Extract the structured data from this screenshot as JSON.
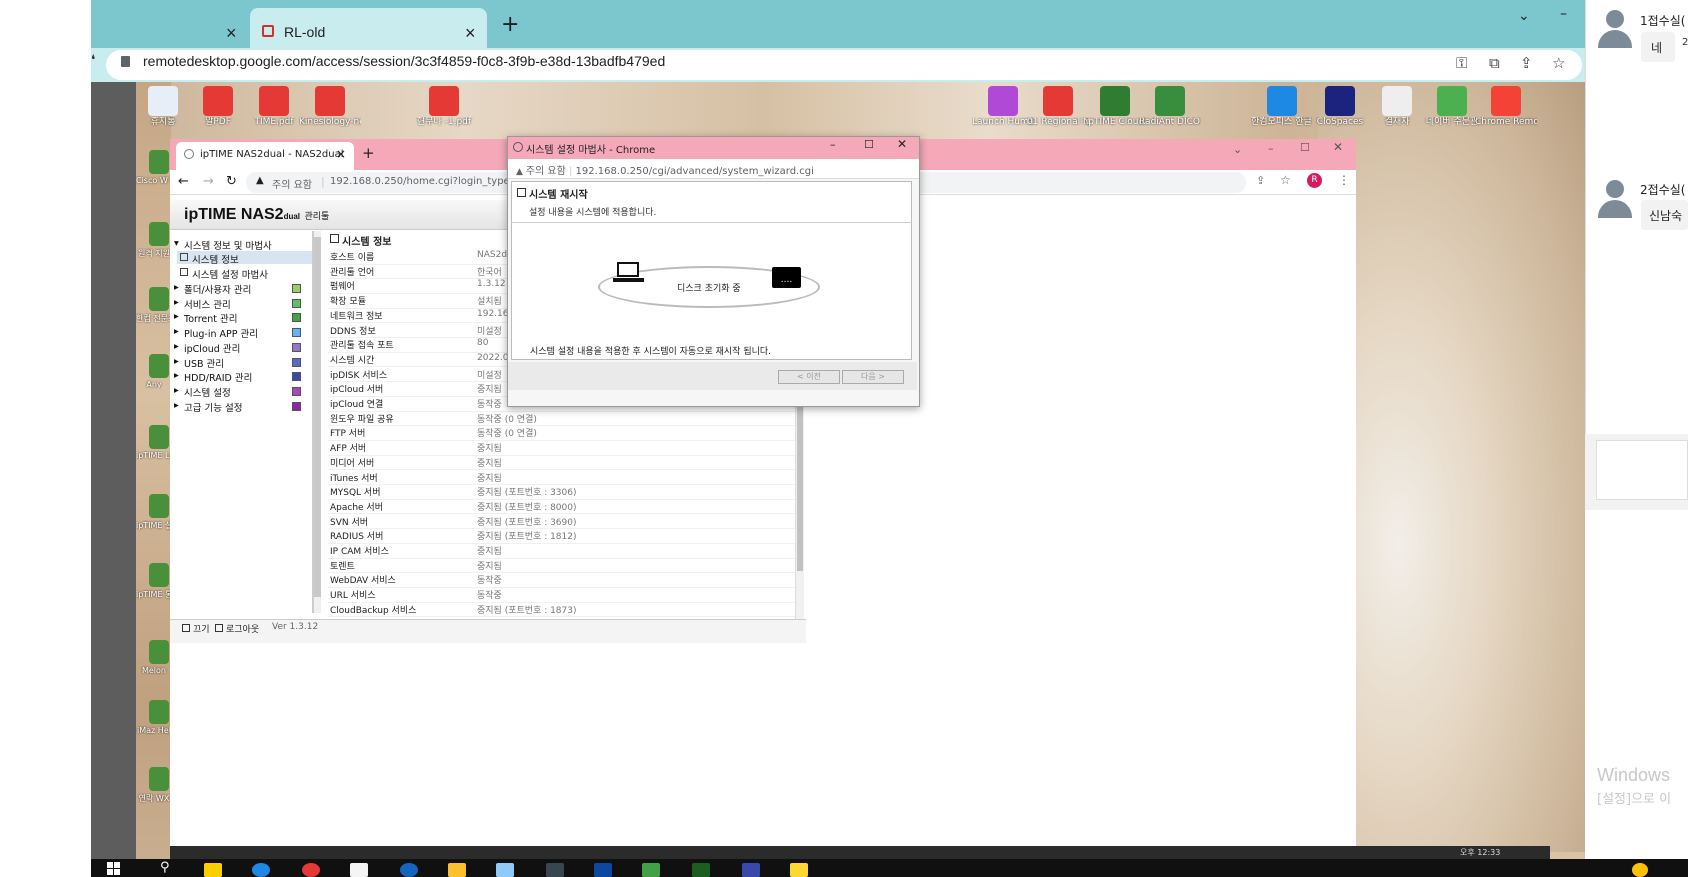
{
  "outer_browser": {
    "tab_active_title": "RL-old",
    "new_tab": "+",
    "url": "remotedesktop.google.com/access/session/3c3f4859-f0c8-3f9b-e38d-13badfb479ed"
  },
  "desktop_icons": [
    {
      "label": "휴지통",
      "color": "#e8eef7"
    },
    {
      "label": "알PDF",
      "color": "#e53935"
    },
    {
      "label": "TIME.pdf",
      "color": "#e53935"
    },
    {
      "label": "Kinesiology-neumann.pdf",
      "color": "#e53935"
    },
    {
      "label": "현무나 -1.pdf",
      "color": "#e53935"
    },
    {
      "label": "Launch Human",
      "color": "#b04ad6"
    },
    {
      "label": "01 Regional News Bio...",
      "color": "#e53935"
    },
    {
      "label": "ipTIME Cloud",
      "color": "#2e7d32"
    },
    {
      "label": "RadiAnt DICO...",
      "color": "#388e3c"
    },
    {
      "label": "한컴오피스 한글 2010",
      "color": "#1e88e5"
    },
    {
      "label": "CloSpaces",
      "color": "#1a237e"
    },
    {
      "label": "결재자",
      "color": "#eeeeee"
    },
    {
      "label": "네이버 주문관",
      "color": "#4caf50"
    },
    {
      "label": "Chrome Remot...",
      "color": "#f44336"
    }
  ],
  "left_desktop_icons": [
    "Cisco W Meet",
    "원격 지원",
    "한컴 전문조",
    "Any",
    "ipTIME Live",
    "ipTIME 설정",
    "ipTIME 통합",
    "Melon",
    "iMaz Hel",
    "연락 WX"
  ],
  "inner_browser": {
    "tab_title": "ipTIME NAS2dual - NAS2dual",
    "url_warning": "주의 요함",
    "url": "192.168.0.250/home.cgi?login_type="
  },
  "nas": {
    "logo": "ipTIME NAS2",
    "logo_sub": "dual",
    "logo_suffix": "관리툴",
    "nav_root": "시스템 정보 및 마법사",
    "nav_children": [
      "시스템 정보",
      "시스템 설정 마법사"
    ],
    "nav_items": [
      "폴더/사용자 관리",
      "서비스 관리",
      "Torrent 관리",
      "Plug-in APP 관리",
      "ipCloud 관리",
      "USB 관리",
      "HDD/RAID 관리",
      "시스템 설정",
      "고급 기능 설정"
    ],
    "panel_title": "시스템 정보",
    "rows": [
      {
        "k": "호스트 이름",
        "v": "NAS2d"
      },
      {
        "k": "관리툴 언어",
        "v": "한국어"
      },
      {
        "k": "펌웨어",
        "v": "1.3.12"
      },
      {
        "k": "확장 모듈",
        "v": "설치됨"
      },
      {
        "k": "네트워크 정보",
        "v": "192.16"
      },
      {
        "k": "DDNS 정보",
        "v": "미설정"
      },
      {
        "k": "관리툴 접속 포트",
        "v": "80"
      },
      {
        "k": "시스템 시간",
        "v": "2022.0"
      },
      {
        "k": "ipDISK 서비스",
        "v": "미설정"
      },
      {
        "k": "ipCloud 서버",
        "v": "중지됨"
      },
      {
        "k": "ipCloud 연결",
        "v": "동작중"
      },
      {
        "k": "윈도우 파일 공유",
        "v": "동작중 (0 연결)"
      },
      {
        "k": "FTP 서버",
        "v": "동작중 (0 연결)"
      },
      {
        "k": "AFP 서버",
        "v": "중지됨"
      },
      {
        "k": "미디어 서버",
        "v": "중지됨"
      },
      {
        "k": "iTunes 서버",
        "v": "중지됨"
      },
      {
        "k": "MYSQL 서버",
        "v": "중지됨 (포트번호 : 3306)"
      },
      {
        "k": "Apache 서버",
        "v": "중지됨 (포트번호 : 8000)"
      },
      {
        "k": "SVN 서버",
        "v": "중지됨 (포트번호 : 3690)"
      },
      {
        "k": "RADIUS 서버",
        "v": "중지됨 (포트번호 : 1812)"
      },
      {
        "k": "IP CAM 서비스",
        "v": "중지됨"
      },
      {
        "k": "토렌트",
        "v": "중지됨"
      },
      {
        "k": "WebDAV 서비스",
        "v": "동작중"
      },
      {
        "k": "URL 서비스",
        "v": "동작중"
      },
      {
        "k": "CloudBackup 서비스",
        "v": "중지됨 (포트번호 : 1873)"
      }
    ],
    "footer_close": "끄기",
    "footer_logout": "로그아웃",
    "footer_version": "Ver 1.3.12"
  },
  "popup": {
    "window_title": "시스템 설정 마법사 - Chrome",
    "addr_warning": "주의 요함",
    "addr_url": "192.168.0.250/cgi/advanced/system_wizard.cgi",
    "section_title": "시스템 재시작",
    "section_sub": "설정 내용을 시스템에 적용합니다.",
    "progress_label": "디스크 초기화 중",
    "server_dots": "....",
    "notice": "시스템 설정 내용을 적용한 후 시스템이 자동으로 재시작 됩니다.",
    "prev_button": "< 이전",
    "next_button": "다음 >"
  },
  "right_panel": {
    "room1_label": "1접수실(",
    "room1_button": "네",
    "room1_frag": "2",
    "room2_label": "2접수실(",
    "room2_text": "신남숙"
  },
  "watermark": {
    "line1": "Windows",
    "line2": "[설정]으로 이"
  },
  "taskbar": {
    "clock": "오후 12:33"
  },
  "colors": {
    "outer_chrome": "#7bc7cd",
    "inner_chrome": "#f5a9b8",
    "accent": "#d81b60"
  }
}
